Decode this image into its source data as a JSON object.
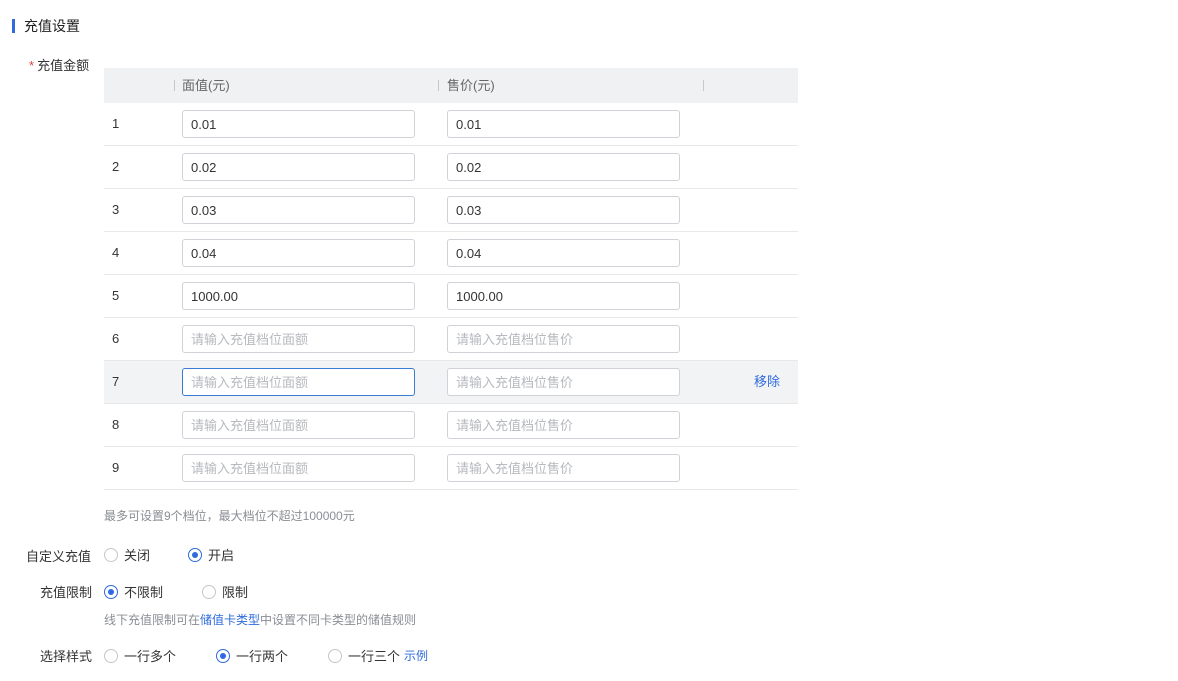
{
  "section": {
    "title": "充值设置"
  },
  "amount_field": {
    "required_mark": "*",
    "label": "充值金额",
    "columns": {
      "face": "面值(元)",
      "price": "售价(元)"
    },
    "face_placeholder": "请输入充值档位面额",
    "price_placeholder": "请输入充值档位售价",
    "rows": [
      {
        "index": "1",
        "face": "0.01",
        "price": "0.01"
      },
      {
        "index": "2",
        "face": "0.02",
        "price": "0.02"
      },
      {
        "index": "3",
        "face": "0.03",
        "price": "0.03"
      },
      {
        "index": "4",
        "face": "0.04",
        "price": "0.04"
      },
      {
        "index": "5",
        "face": "1000.00",
        "price": "1000.00"
      },
      {
        "index": "6",
        "face": "",
        "price": ""
      },
      {
        "index": "7",
        "face": "",
        "price": "",
        "remove_label": "移除"
      },
      {
        "index": "8",
        "face": "",
        "price": ""
      },
      {
        "index": "9",
        "face": "",
        "price": ""
      }
    ],
    "hint": "最多可设置9个档位，最大档位不超过100000元"
  },
  "custom_recharge": {
    "label": "自定义充值",
    "options": [
      "关闭",
      "开启"
    ],
    "selected": "开启"
  },
  "recharge_limit": {
    "label": "充值限制",
    "options": [
      "不限制",
      "限制"
    ],
    "selected": "不限制",
    "hint_prefix": "线下充值限制可在",
    "hint_link": "储值卡类型",
    "hint_suffix": "中设置不同卡类型的储值规则"
  },
  "style_select": {
    "label": "选择样式",
    "options": [
      "一行多个",
      "一行两个",
      "一行三个"
    ],
    "selected": "一行两个",
    "example_link": "示例"
  },
  "colors": {
    "accent": "#2f6bdb",
    "required": "#e5413c",
    "header_bg": "#f0f1f3",
    "hover_row": "#f2f3f5"
  }
}
